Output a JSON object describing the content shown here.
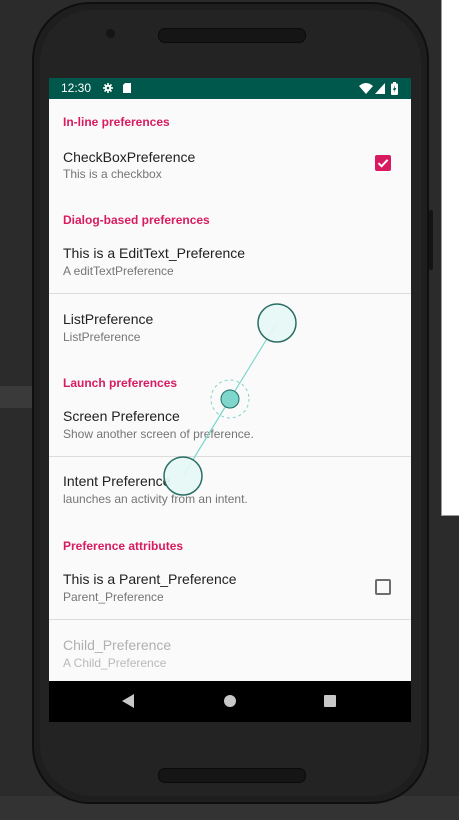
{
  "status_bar": {
    "time": "12:30",
    "icons": [
      "gear-icon",
      "sd-card-icon",
      "wifi-icon",
      "signal-icon",
      "battery-icon"
    ],
    "background": "#00574b"
  },
  "categories": {
    "inline": "In-line preferences",
    "dialog": "Dialog-based preferences",
    "launch": "Launch preferences",
    "attributes": "Preference attributes"
  },
  "preferences": {
    "checkbox": {
      "title": "CheckBoxPreference",
      "summary": "This is a checkbox",
      "checked": true
    },
    "edittext": {
      "title": "This is a EditText_Preference",
      "summary": "A editTextPreference"
    },
    "list": {
      "title": "ListPreference",
      "summary": "ListPreference"
    },
    "screen": {
      "title": "Screen Preference",
      "summary": "Show another screen of preference."
    },
    "intent": {
      "title": "Intent Preference",
      "summary": "launches an activity from an intent."
    },
    "parent": {
      "title": "This is a Parent_Preference",
      "summary": "Parent_Preference",
      "checked": false
    },
    "child": {
      "title": "Child_Preference",
      "summary": "A Child_Preference",
      "enabled": false
    }
  },
  "nav_bar": {
    "icons": [
      "back-icon",
      "home-icon",
      "recents-icon"
    ]
  },
  "colors": {
    "accent": "#d81b60",
    "status_bar": "#00574b",
    "touch_indicator": "#7fd6cc"
  }
}
